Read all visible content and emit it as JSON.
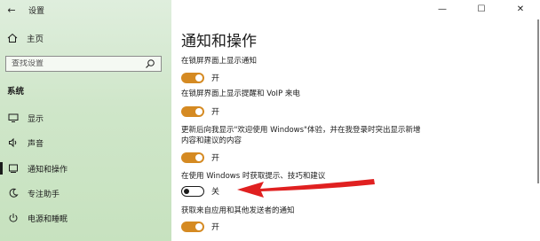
{
  "window": {
    "title": "设置",
    "back_glyph": "←",
    "minimize_glyph": "—",
    "maximize_glyph": "☐",
    "close_glyph": "✕"
  },
  "sidebar": {
    "home_label": "主页",
    "search_placeholder": "查找设置",
    "section_label": "系统",
    "items": [
      {
        "label": "显示",
        "icon": "display-icon"
      },
      {
        "label": "声音",
        "icon": "sound-icon"
      },
      {
        "label": "通知和操作",
        "icon": "notifications-icon",
        "active": true
      },
      {
        "label": "专注助手",
        "icon": "focus-assist-icon"
      },
      {
        "label": "电源和睡眠",
        "icon": "power-icon"
      }
    ]
  },
  "main": {
    "title": "通知和操作",
    "settings": [
      {
        "label": "在锁屏界面上显示通知",
        "state": "开",
        "on": true
      },
      {
        "label": "在锁屏界面上显示提醒和 VoIP 来电",
        "state": "开",
        "on": true
      },
      {
        "label_line1": "更新后向我显示\"欢迎使用 Windows\"体验，并在我登录时突出显示新增",
        "label_line2": "内容和建议的内容",
        "state": "开",
        "on": true
      },
      {
        "label": "在使用 Windows 时获取提示、技巧和建议",
        "state": "关",
        "on": false
      },
      {
        "label": "获取来自应用和其他发送者的通知",
        "state": "开",
        "on": true
      }
    ]
  },
  "colors": {
    "accent": "#d58a22",
    "annotation_arrow": "#e02020",
    "sidebar_bg": "#cfe6c9"
  }
}
